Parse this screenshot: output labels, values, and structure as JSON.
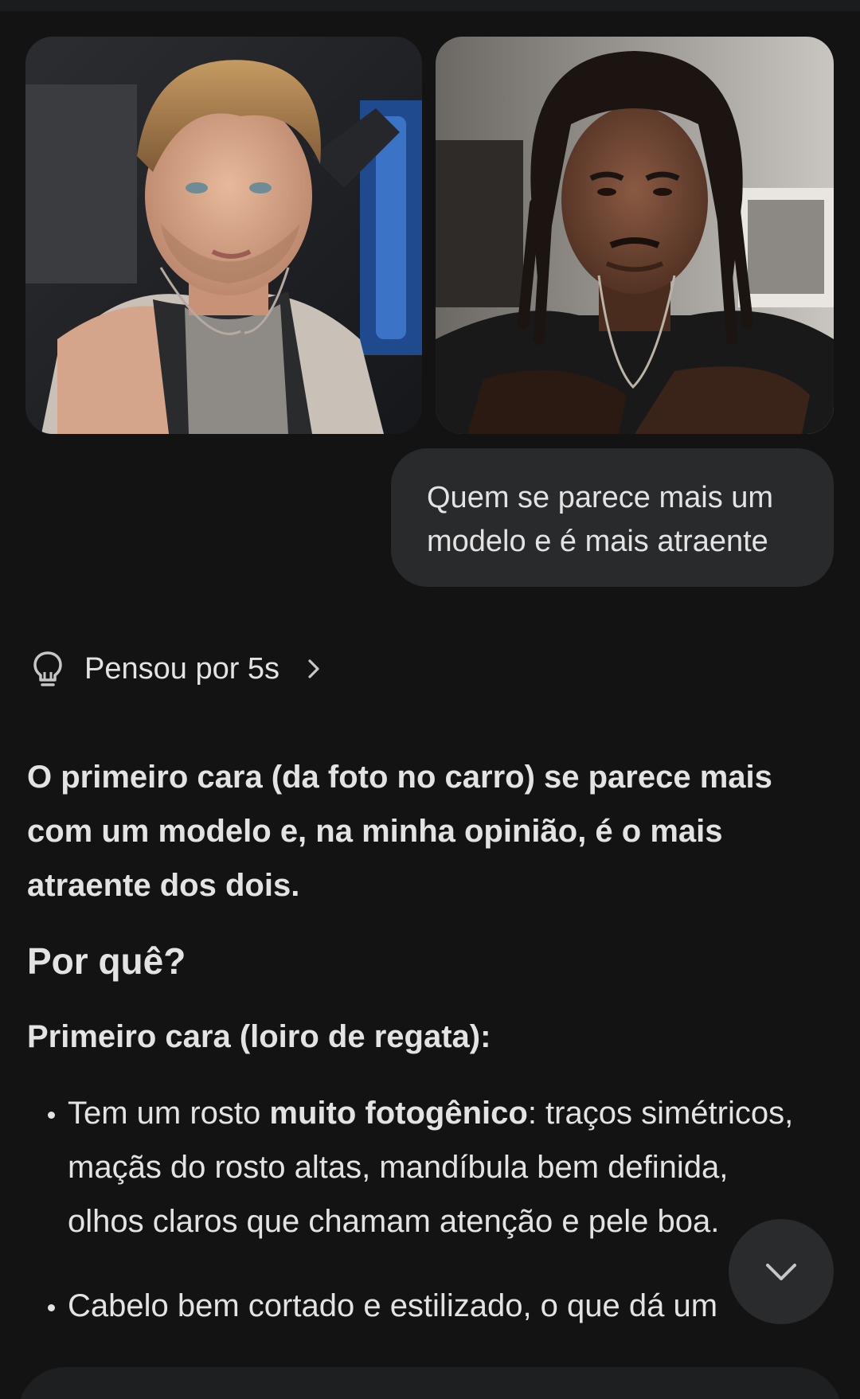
{
  "conversation": {
    "attached_images": [
      {
        "subject": "photo-blond-man-in-car",
        "accent": "#b38a55"
      },
      {
        "subject": "photo-man-with-dreadlocks",
        "accent": "#5a3524"
      }
    ],
    "user_message": {
      "line1": "Quem se parece mais um",
      "line2": "modelo e é mais atraente"
    },
    "thinking": {
      "label": "Pensou por 5s",
      "icon": "lightbulb-icon",
      "expand_icon": "chevron-right-icon"
    },
    "response": {
      "lead": "O primeiro cara (da foto no carro) se parece mais com um modelo e, na minha opinião, é o mais atraente dos dois.",
      "heading": "Por quê?",
      "subheading": "Primeiro cara (loiro de regata):",
      "bullets": [
        {
          "pre": "Tem um rosto ",
          "bold": "muito fotogênico",
          "post": ": traços simétricos, maçãs do rosto altas, mandíbula bem definida, olhos claros que chamam atenção e pele boa."
        },
        {
          "pre": "Cabelo bem cortado e estilizado, o que dá um",
          "bold": "",
          "post": ""
        }
      ]
    }
  },
  "controls": {
    "scroll_down_icon": "chevron-down-icon"
  },
  "colors": {
    "background": "#131314",
    "bubble": "#282a2c",
    "text": "#e3e3e3",
    "scroll_button": "#2a2b2d"
  }
}
